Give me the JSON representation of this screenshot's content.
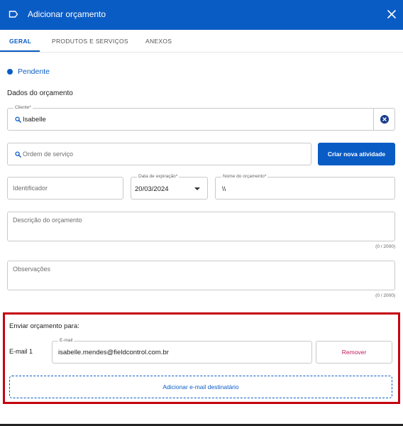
{
  "header": {
    "title": "Adicionar orçamento",
    "icon": "tag-icon",
    "close_icon": "close-icon"
  },
  "tabs": [
    {
      "label": "GERAL",
      "active": true
    },
    {
      "label": "PRODUTOS E SERVIÇOS",
      "active": false
    },
    {
      "label": "ANEXOS",
      "active": false
    }
  ],
  "status": {
    "label": "Pendente"
  },
  "section": {
    "title": "Dados do orçamento"
  },
  "client": {
    "label": "Cliente*",
    "value": "Isabelle"
  },
  "service_order": {
    "placeholder": "Ordem de serviço"
  },
  "create_activity": {
    "label": "Criar nova atividade"
  },
  "identifier": {
    "placeholder": "Identificador"
  },
  "expiration": {
    "label": "Data de expiração*",
    "value": "20/03/2024"
  },
  "budget_name": {
    "label": "Nome do orçamento*",
    "value": "\\\\"
  },
  "description": {
    "placeholder": "Descrição do orçamento",
    "counter": "(0 / 2000)"
  },
  "observations": {
    "placeholder": "Observações",
    "counter": "(0 / 2000)"
  },
  "send": {
    "title": "Enviar orçamento para:",
    "email_label": "E-mail 1",
    "email_field_label": "E-mail",
    "email_value": "isabelle.mendes@fieldcontrol.com.br",
    "remove_label": "Remover",
    "add_label": "Adicionar e-mail destinatário"
  },
  "colors": {
    "primary": "#0a5cc5",
    "danger": "#c2185b",
    "highlight": "#c4000f"
  }
}
